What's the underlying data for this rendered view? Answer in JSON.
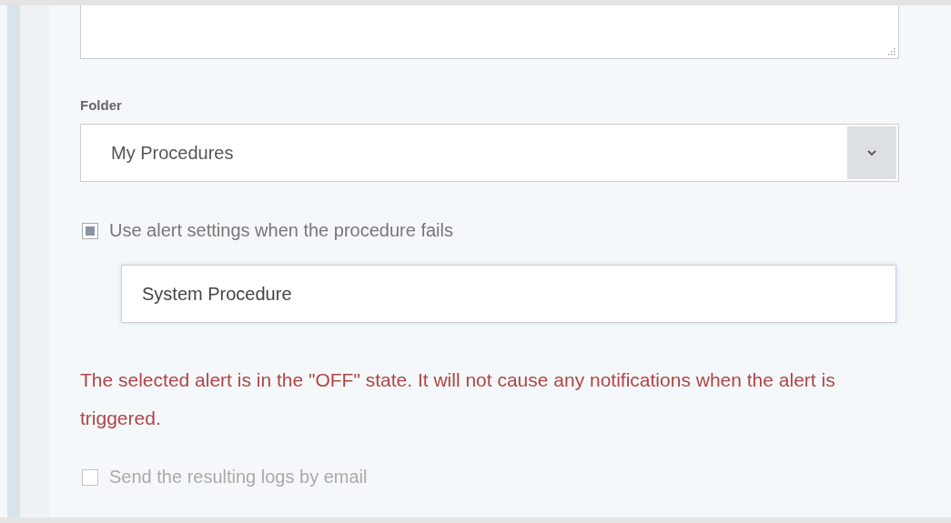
{
  "folder": {
    "label": "Folder",
    "value": "My Procedures"
  },
  "options": [
    {
      "kind": "checkbox",
      "label": "Use alert settings when the procedure fails",
      "checked": true,
      "disabled": false
    },
    {
      "kind": "field",
      "value": "System Procedure"
    },
    {
      "kind": "warning",
      "text": "The selected alert is in the \"OFF\" state. It will not cause any notifications when the alert is triggered."
    },
    {
      "kind": "checkbox",
      "label": "Send the resulting logs by email",
      "checked": false,
      "disabled": true
    }
  ]
}
